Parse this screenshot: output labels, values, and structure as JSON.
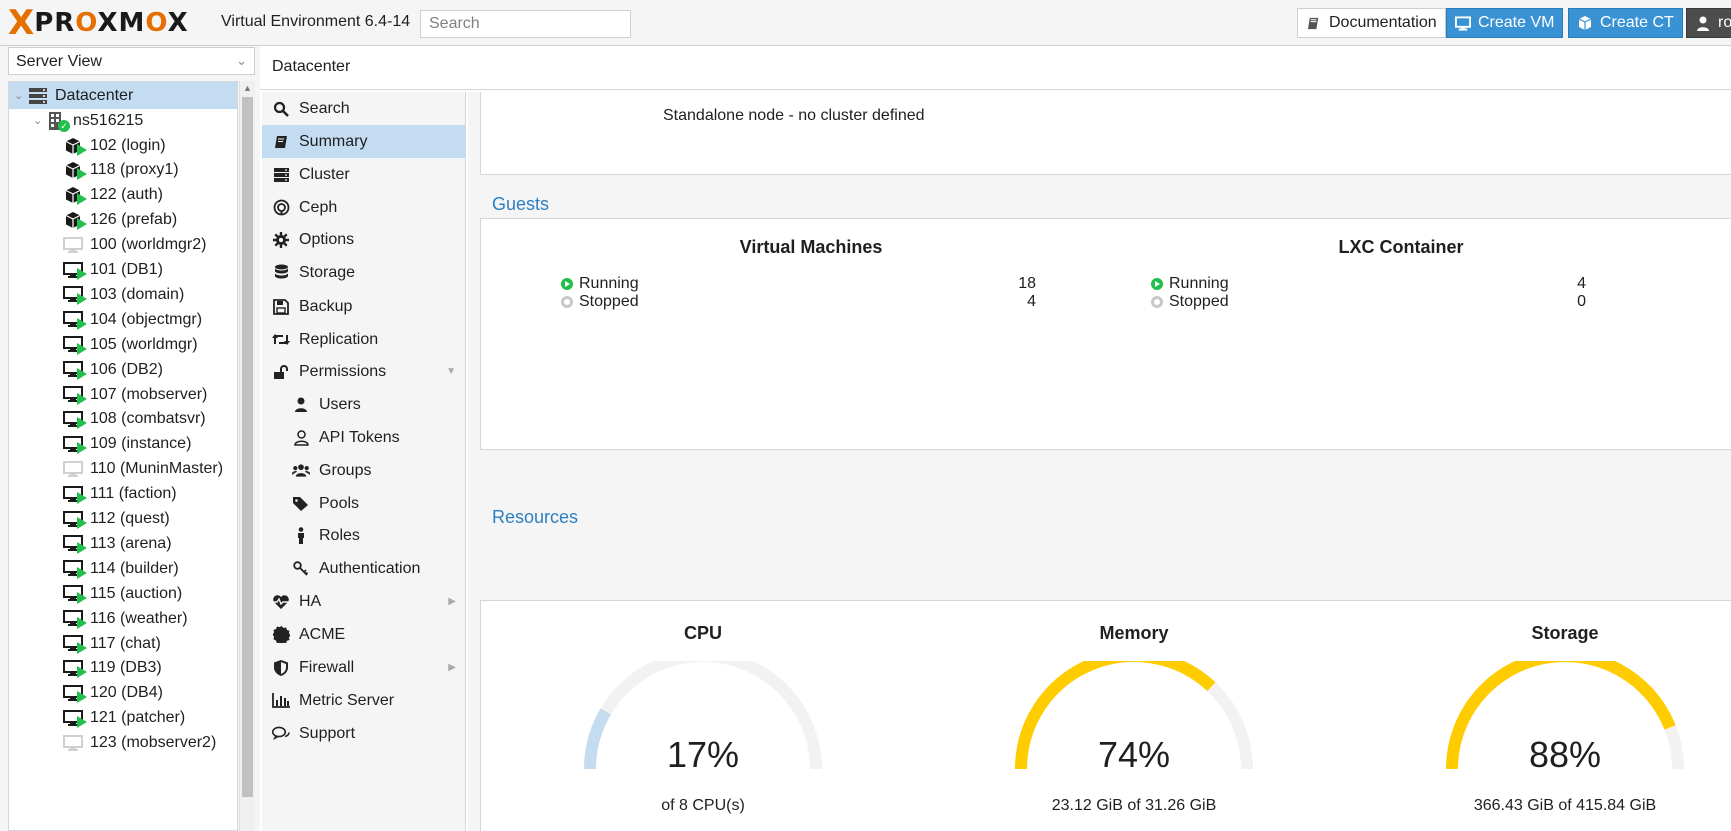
{
  "header": {
    "logo_text": "PROXMOX",
    "version": "Virtual Environment 6.4-14",
    "search_placeholder": "Search",
    "buttons": {
      "documentation": "Documentation",
      "create_vm": "Create VM",
      "create_ct": "Create CT",
      "user": "ro"
    }
  },
  "tree": {
    "view": "Server View",
    "datacenter": "Datacenter",
    "node": "ns516215",
    "guests": [
      {
        "label": "102 (login)",
        "kind": "ct",
        "running": true
      },
      {
        "label": "118 (proxy1)",
        "kind": "ct",
        "running": true
      },
      {
        "label": "122 (auth)",
        "kind": "ct",
        "running": true
      },
      {
        "label": "126 (prefab)",
        "kind": "ct",
        "running": true
      },
      {
        "label": "100 (worldmgr2)",
        "kind": "vm",
        "running": false
      },
      {
        "label": "101 (DB1)",
        "kind": "vm",
        "running": true
      },
      {
        "label": "103 (domain)",
        "kind": "vm",
        "running": true
      },
      {
        "label": "104 (objectmgr)",
        "kind": "vm",
        "running": true
      },
      {
        "label": "105 (worldmgr)",
        "kind": "vm",
        "running": true
      },
      {
        "label": "106 (DB2)",
        "kind": "vm",
        "running": true
      },
      {
        "label": "107 (mobserver)",
        "kind": "vm",
        "running": true
      },
      {
        "label": "108 (combatsvr)",
        "kind": "vm",
        "running": true
      },
      {
        "label": "109 (instance)",
        "kind": "vm",
        "running": true
      },
      {
        "label": "110 (MuninMaster)",
        "kind": "vm",
        "running": false
      },
      {
        "label": "111 (faction)",
        "kind": "vm",
        "running": true
      },
      {
        "label": "112 (quest)",
        "kind": "vm",
        "running": true
      },
      {
        "label": "113 (arena)",
        "kind": "vm",
        "running": true
      },
      {
        "label": "114 (builder)",
        "kind": "vm",
        "running": true
      },
      {
        "label": "115 (auction)",
        "kind": "vm",
        "running": true
      },
      {
        "label": "116 (weather)",
        "kind": "vm",
        "running": true
      },
      {
        "label": "117 (chat)",
        "kind": "vm",
        "running": true
      },
      {
        "label": "119 (DB3)",
        "kind": "vm",
        "running": true
      },
      {
        "label": "120 (DB4)",
        "kind": "vm",
        "running": true
      },
      {
        "label": "121 (patcher)",
        "kind": "vm",
        "running": true
      },
      {
        "label": "123 (mobserver2)",
        "kind": "vm",
        "running": false
      }
    ]
  },
  "breadcrumb": "Datacenter",
  "menu": {
    "items": [
      {
        "label": "Search",
        "icon": "search-icon"
      },
      {
        "label": "Summary",
        "icon": "book-icon"
      },
      {
        "label": "Cluster",
        "icon": "server-icon"
      },
      {
        "label": "Ceph",
        "icon": "ceph-icon"
      },
      {
        "label": "Options",
        "icon": "gear-icon"
      },
      {
        "label": "Storage",
        "icon": "database-icon"
      },
      {
        "label": "Backup",
        "icon": "floppy-icon"
      },
      {
        "label": "Replication",
        "icon": "retweet-icon"
      },
      {
        "label": "Permissions",
        "icon": "unlock-icon"
      },
      {
        "label": "Users",
        "icon": "user-icon"
      },
      {
        "label": "API Tokens",
        "icon": "user-outline-icon"
      },
      {
        "label": "Groups",
        "icon": "users-icon"
      },
      {
        "label": "Pools",
        "icon": "tags-icon"
      },
      {
        "label": "Roles",
        "icon": "male-icon"
      },
      {
        "label": "Authentication",
        "icon": "key-icon"
      },
      {
        "label": "HA",
        "icon": "heartbeat-icon"
      },
      {
        "label": "ACME",
        "icon": "certificate-icon"
      },
      {
        "label": "Firewall",
        "icon": "shield-icon"
      },
      {
        "label": "Metric Server",
        "icon": "bar-chart-icon"
      },
      {
        "label": "Support",
        "icon": "comments-icon"
      }
    ]
  },
  "summary": {
    "health_text": "Standalone node - no cluster defined",
    "guests": {
      "title": "Guests",
      "vm": {
        "title": "Virtual Machines",
        "running_label": "Running",
        "running": "18",
        "stopped_label": "Stopped",
        "stopped": "4"
      },
      "lxc": {
        "title": "LXC Container",
        "running_label": "Running",
        "running": "4",
        "stopped_label": "Stopped",
        "stopped": "0"
      }
    },
    "resources": {
      "title": "Resources",
      "cpu": {
        "title": "CPU",
        "percent": "17%",
        "fraction": 0.17,
        "detail": "of 8 CPU(s)"
      },
      "memory": {
        "title": "Memory",
        "percent": "74%",
        "fraction": 0.74,
        "detail": "23.12 GiB of 31.26 GiB"
      },
      "storage": {
        "title": "Storage",
        "percent": "88%",
        "fraction": 0.88,
        "detail": "366.43 GiB of 415.84 GiB"
      }
    }
  },
  "colors": {
    "accent": "#3892d4",
    "gauge_low": "#c5dcf0",
    "gauge_high": "#ffcc00",
    "gauge_track": "#f2f2f2",
    "running": "#21bf4b",
    "selection": "#c3dcf1"
  }
}
